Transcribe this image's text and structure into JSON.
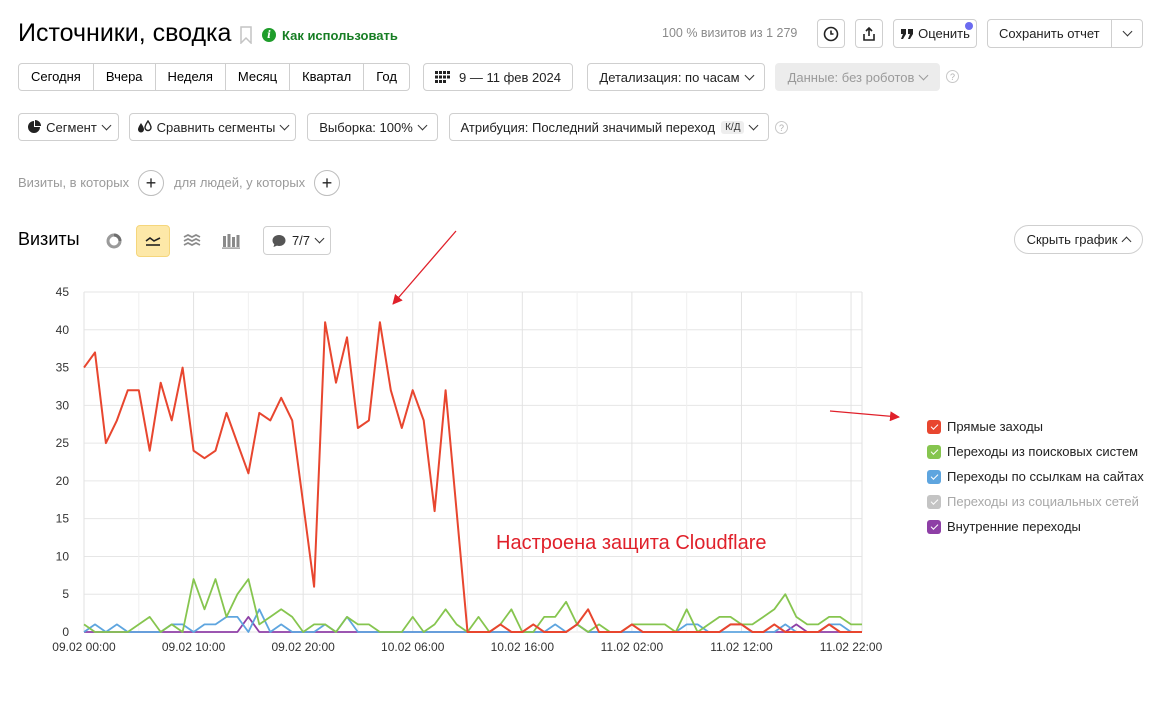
{
  "header": {
    "title": "Источники, сводка",
    "how_to_use": "Как использовать",
    "visits_share": "100 % визитов из 1 279",
    "rate_label": "Оценить",
    "save_report_label": "Сохранить отчет"
  },
  "period_buttons": [
    "Сегодня",
    "Вчера",
    "Неделя",
    "Месяц",
    "Квартал",
    "Год"
  ],
  "date_range": "9 — 11 фев 2024",
  "detail": "Детализация: по часам",
  "data_filter": "Данные: без роботов",
  "segment": "Сегмент",
  "compare_segments": "Сравнить сегменты",
  "sample": "Выборка: 100%",
  "attribution": "Атрибуция: Последний значимый переход",
  "attribution_badge": "К/Д",
  "filters": {
    "visits_label": "Визиты, в которых",
    "people_label": "для людей, у которых"
  },
  "chart_header": {
    "title": "Визиты",
    "annotations_count": "7/7",
    "hide_chart": "Скрыть график"
  },
  "annotation_text": "Настроена защита Cloudflare",
  "colors": {
    "direct": "#e8462f",
    "search": "#86c54f",
    "links": "#5ea5df",
    "social": "#c4c4c4",
    "internal": "#8e3fa6",
    "accent_green": "#177e24",
    "annotation_red": "#e0202a"
  },
  "chart_data": {
    "type": "line",
    "ylim": [
      0,
      45
    ],
    "y_ticks": [
      0,
      5,
      10,
      15,
      20,
      25,
      30,
      35,
      40,
      45
    ],
    "x_tick_labels": [
      "09.02 00:00",
      "09.02 10:00",
      "09.02 20:00",
      "10.02 06:00",
      "10.02 16:00",
      "11.02 02:00",
      "11.02 12:00",
      "11.02 22:00"
    ],
    "x_tick_index": [
      0,
      10,
      20,
      30,
      40,
      50,
      60,
      70
    ],
    "series": [
      {
        "name": "Прямые заходы",
        "key": "direct",
        "visible": true,
        "values": [
          35,
          37,
          25,
          28,
          32,
          32,
          24,
          33,
          28,
          35,
          24,
          23,
          24,
          29,
          25,
          21,
          29,
          28,
          31,
          28,
          17,
          6,
          41,
          33,
          39,
          27,
          28,
          41,
          32,
          27,
          32,
          28,
          16,
          32,
          16,
          0,
          0,
          0,
          1,
          0,
          0,
          1,
          0,
          0,
          0,
          1,
          3,
          0,
          0,
          0,
          1,
          0,
          0,
          0,
          0,
          0,
          0,
          0,
          0,
          1,
          1,
          0,
          0,
          1,
          0,
          0,
          0,
          0,
          1,
          0,
          0,
          0
        ]
      },
      {
        "name": "Переходы из поисковых систем",
        "key": "search",
        "visible": true,
        "values": [
          1,
          0,
          0,
          0,
          0,
          1,
          2,
          0,
          1,
          0,
          7,
          3,
          7,
          2,
          5,
          7,
          1,
          2,
          3,
          2,
          0,
          1,
          1,
          0,
          2,
          1,
          1,
          0,
          0,
          0,
          2,
          0,
          1,
          3,
          1,
          0,
          2,
          0,
          1,
          3,
          0,
          0,
          2,
          2,
          4,
          1,
          0,
          1,
          0,
          0,
          1,
          1,
          1,
          1,
          0,
          3,
          0,
          1,
          2,
          2,
          1,
          1,
          2,
          3,
          5,
          2,
          1,
          1,
          2,
          2,
          1,
          1
        ]
      },
      {
        "name": "Переходы по ссылкам на сайтах",
        "key": "links",
        "visible": true,
        "values": [
          0,
          1,
          0,
          1,
          0,
          0,
          0,
          0,
          1,
          1,
          0,
          1,
          1,
          2,
          2,
          0,
          3,
          0,
          1,
          0,
          0,
          0,
          1,
          0,
          2,
          0,
          0,
          0,
          0,
          0,
          0,
          0,
          0,
          0,
          0,
          0,
          0,
          0,
          0,
          0,
          0,
          0,
          0,
          1,
          0,
          1,
          0,
          0,
          0,
          0,
          0,
          0,
          0,
          0,
          0,
          1,
          1,
          0,
          0,
          0,
          0,
          0,
          0,
          0,
          1,
          0,
          0,
          0,
          1,
          1,
          0,
          0
        ]
      },
      {
        "name": "Переходы из социальных сетей",
        "key": "social",
        "visible": false,
        "values": []
      },
      {
        "name": "Внутренние переходы",
        "key": "internal",
        "visible": true,
        "values": [
          0,
          0,
          0,
          0,
          0,
          0,
          0,
          0,
          0,
          0,
          0,
          0,
          0,
          0,
          0,
          2,
          0,
          0,
          0,
          0,
          0,
          0,
          0,
          0,
          0,
          0,
          0,
          0,
          0,
          0,
          0,
          0,
          0,
          0,
          0,
          0,
          0,
          0,
          0,
          0,
          0,
          0,
          0,
          0,
          0,
          1,
          0,
          0,
          0,
          0,
          0,
          0,
          0,
          0,
          0,
          0,
          0,
          0,
          0,
          1,
          1,
          0,
          0,
          0,
          0,
          1,
          0,
          0,
          0,
          0,
          0,
          0
        ]
      }
    ]
  }
}
